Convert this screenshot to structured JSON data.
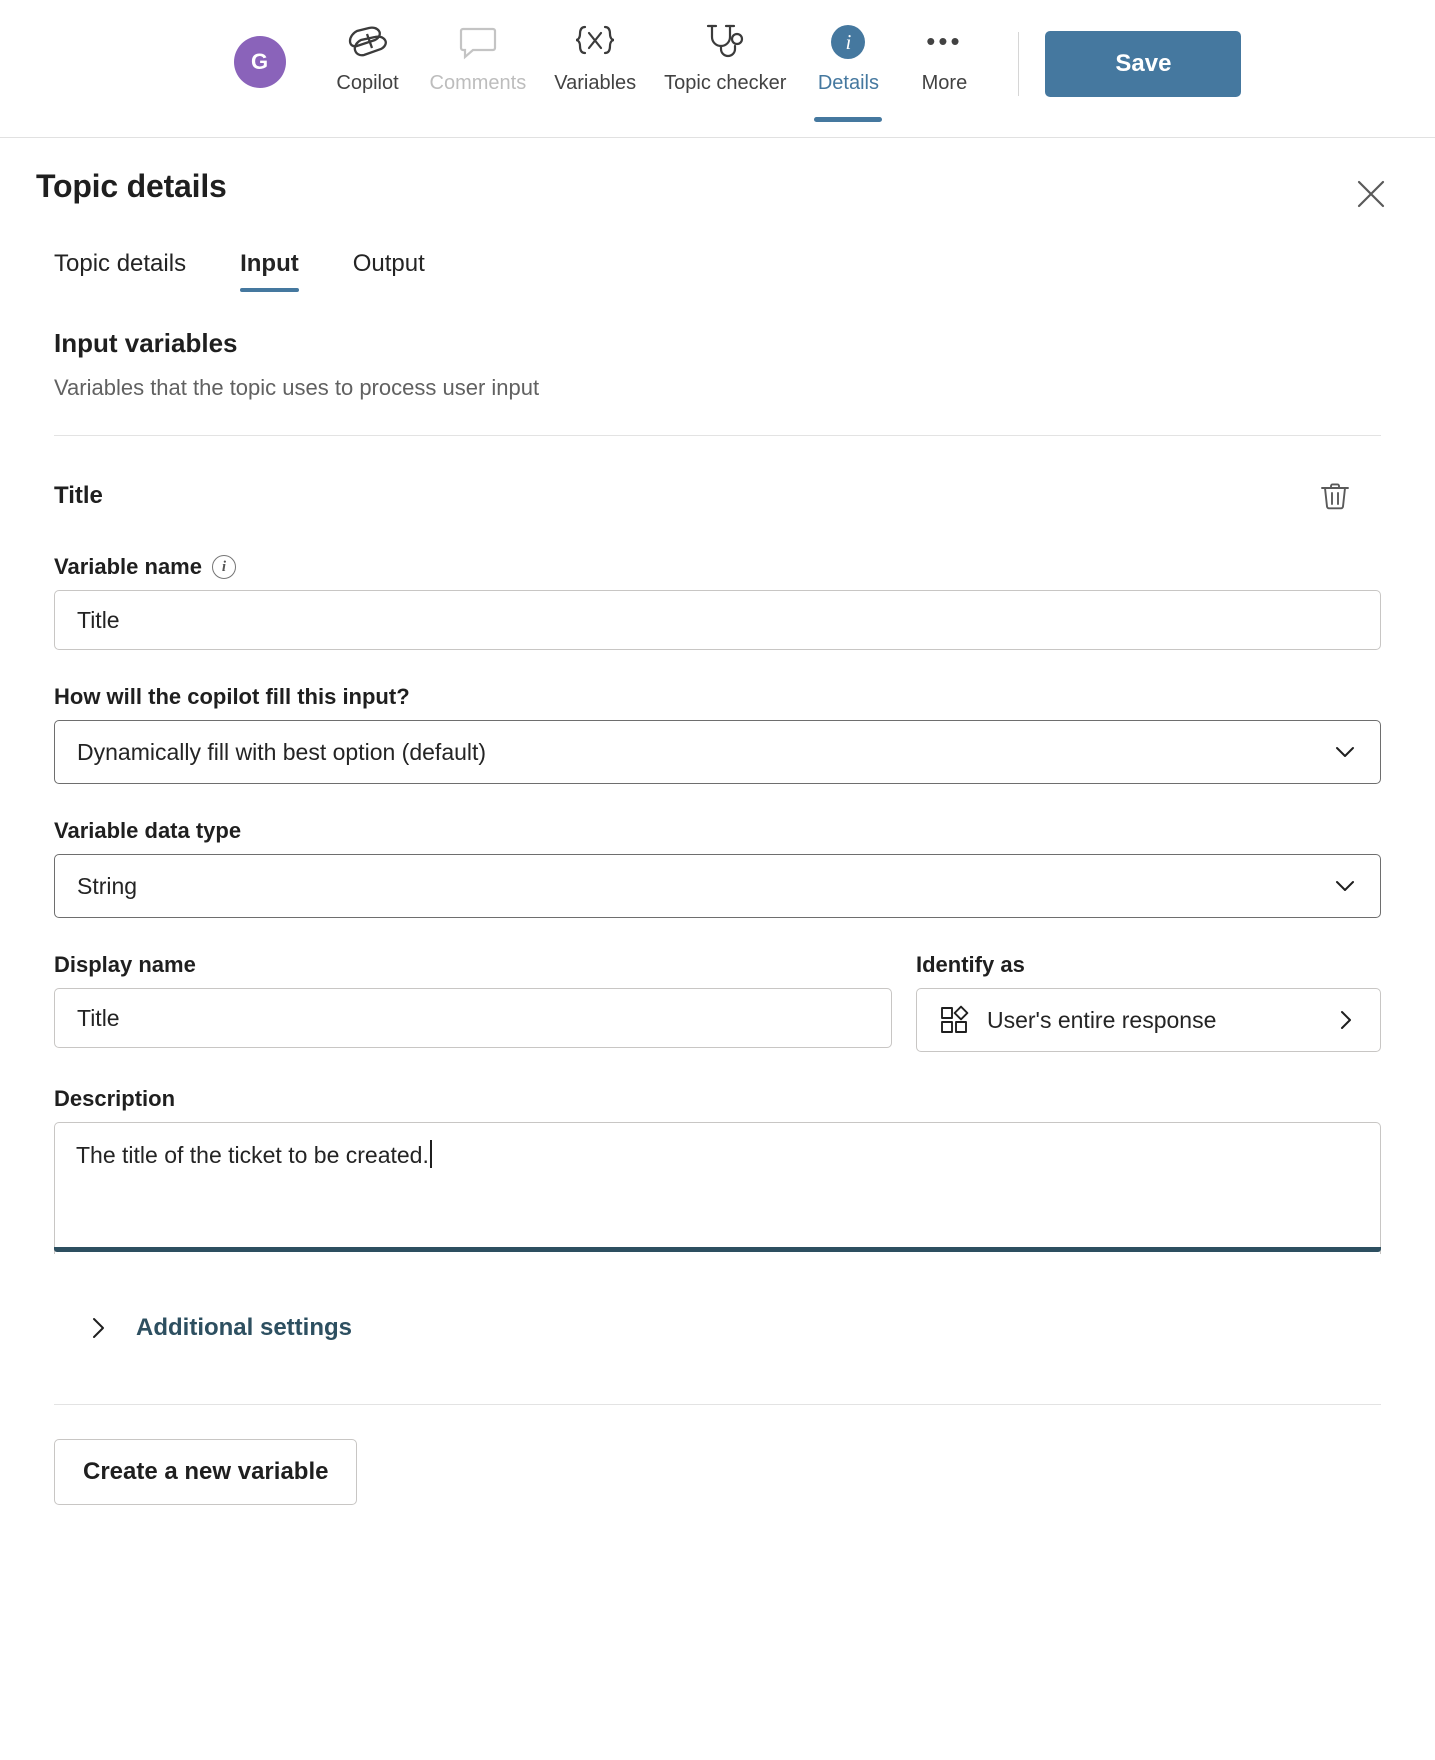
{
  "topbar": {
    "avatar_initial": "G",
    "commands": [
      {
        "label": "Copilot",
        "icon": "copilot-icon",
        "state": "normal"
      },
      {
        "label": "Comments",
        "icon": "comment-icon",
        "state": "disabled"
      },
      {
        "label": "Variables",
        "icon": "variables-icon",
        "state": "normal"
      },
      {
        "label": "Topic checker",
        "icon": "stethoscope-icon",
        "state": "normal"
      },
      {
        "label": "Details",
        "icon": "info-circle-icon",
        "state": "selected"
      },
      {
        "label": "More",
        "icon": "ellipsis-icon",
        "state": "normal"
      }
    ],
    "save_label": "Save",
    "accent_color": "#45789f"
  },
  "panel": {
    "title": "Topic details",
    "close_icon": "close-icon",
    "tabs": [
      {
        "label": "Topic details",
        "active": false
      },
      {
        "label": "Input",
        "active": true
      },
      {
        "label": "Output",
        "active": false
      }
    ],
    "section": {
      "heading": "Input variables",
      "subheading": "Variables that the topic uses to process user input"
    },
    "variable": {
      "name": "Title",
      "delete_icon": "trash-icon",
      "variable_name_label": "Variable name",
      "variable_name_info_icon": "info-icon",
      "variable_name_value": "Title",
      "fill_label": "How will the copilot fill this input?",
      "fill_value": "Dynamically fill with best option (default)",
      "data_type_label": "Variable data type",
      "data_type_value": "String",
      "display_name_label": "Display name",
      "display_name_value": "Title",
      "identify_as_label": "Identify as",
      "identify_as_value": "User's entire response",
      "identify_as_icon": "entity-icon",
      "identify_as_chevron": "chevron-right-icon",
      "description_label": "Description",
      "description_value": "The title of the ticket to be created.",
      "additional_settings_label": "Additional settings",
      "additional_settings_icon": "chevron-right-icon",
      "focus_color": "#2d4f60"
    },
    "create_variable_label": "Create a new variable"
  }
}
